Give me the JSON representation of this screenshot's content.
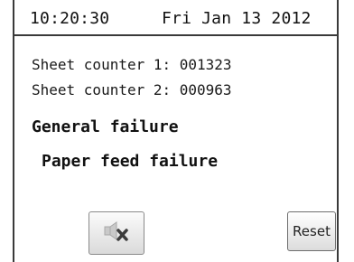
{
  "header": {
    "time": "10:20:30",
    "date": "Fri Jan 13 2012"
  },
  "counters": [
    {
      "text": "Sheet counter 1: 001323"
    },
    {
      "text": "Sheet counter 2: 000963"
    }
  ],
  "errors": {
    "general": "General failure",
    "detail": "Paper feed failure"
  },
  "buttons": {
    "mute_icon": "speaker-muted-icon",
    "reset_label": "Reset"
  },
  "colors": {
    "frame": "#3a3a3a",
    "background": "#ffffff",
    "text": "#111111",
    "mute_x": "#3c3c3c"
  }
}
